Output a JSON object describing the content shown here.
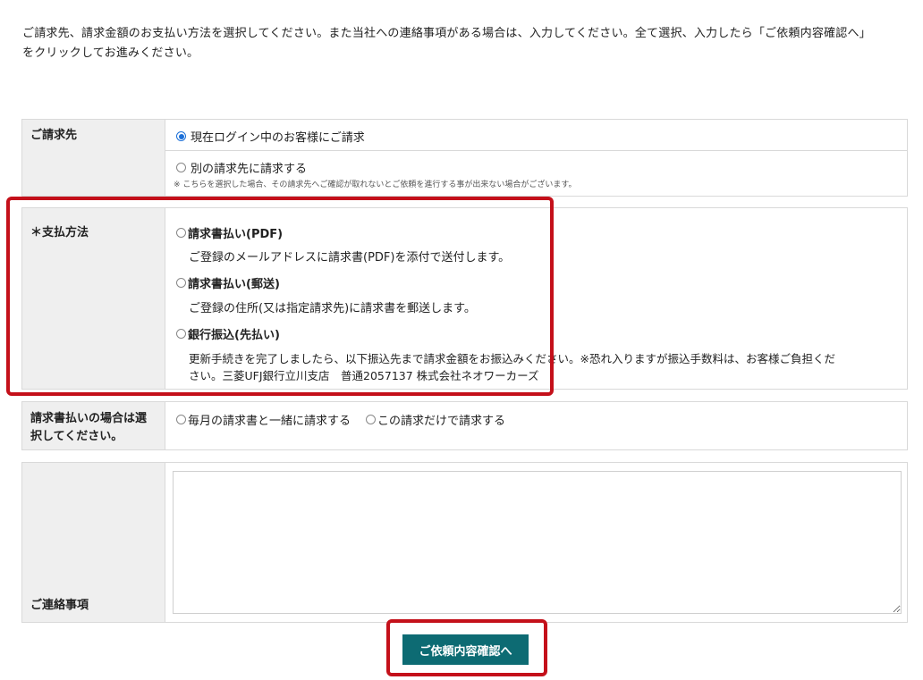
{
  "intro": {
    "line1": "ご請求先、請求金額のお支払い方法を選択してください。また当社への連絡事項がある場合は、入力してください。全て選択、入力したら「ご依頼内容確認へ」",
    "line2": "をクリックしてお進みください。"
  },
  "billing": {
    "label": "ご請求先",
    "option1": {
      "label": "現在ログイン中のお客様にご請求",
      "selected": true
    },
    "option2": {
      "label": "別の請求先に請求する",
      "selected": false
    },
    "note": "※ こちらを選択した場合、その請求先へご確認が取れないとご依頼を進行する事が出来ない場合がございます。"
  },
  "payment": {
    "label": "＊支払方法",
    "options": [
      {
        "title": "請求書払い(PDF)",
        "desc": "ご登録のメールアドレスに請求書(PDF)を添付で送付します。"
      },
      {
        "title": "請求書払い(郵送)",
        "desc": "ご登録の住所(又は指定請求先)に請求書を郵送します。"
      },
      {
        "title": "銀行振込(先払い)",
        "desc1": "更新手続きを完了しましたら、以下振込先まで請求金額をお振込みください。※恐れ入りますが振込手数料は、お客様ご負担くだ",
        "desc2": "さい。三菱UFJ銀行立川支店　普通2057137 株式会社ネオワーカーズ"
      }
    ]
  },
  "invoice_pref": {
    "label_line1": "請求書払いの場合は選",
    "label_line2": "択してください。",
    "option1": "毎月の請求書と一緒に請求する",
    "option2": "この請求だけで請求する"
  },
  "contact": {
    "label": "ご連絡事項",
    "value": "",
    "placeholder": ""
  },
  "submit_label": "ご依頼内容確認へ",
  "colors": {
    "highlight": "#c4101a",
    "button": "#0d6b73",
    "label_bg": "#efefef",
    "radio_selected": "#1a6fd8"
  }
}
